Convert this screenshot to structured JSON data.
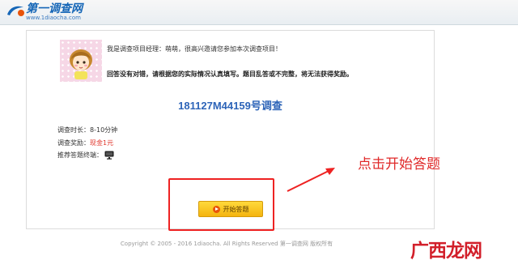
{
  "site": {
    "logo_text": "第一调查网",
    "logo_domain": "www.1diaocha.com"
  },
  "survey": {
    "greeting": "我是调查项目经理：萌萌，很高兴邀请您参加本次调查项目！",
    "instructions": "回答没有对错，请根据您的实际情况认真填写。题目乱答或不完整，将无法获得奖励。",
    "title": "181127M44159号调查",
    "duration_label": "调查时长：",
    "duration_value": "8-10分钟",
    "reward_label": "调查奖励：",
    "reward_value": "现金1元",
    "terminal_label": "推荐答题终端：",
    "terminal_icon": "desktop-monitor-icon",
    "start_button_label": "开始答题"
  },
  "annotation": {
    "text": "点击开始答题",
    "color": "#e02a2a"
  },
  "footer": {
    "copyright": "Copyright © 2005 - 2016 1diaocha. All Rights Reserved    第一调查网 版权所有"
  },
  "watermark": {
    "text": "广西龙网"
  },
  "colors": {
    "brand_blue": "#1566b7",
    "title_blue": "#2d64b8",
    "reward_red": "#e0352b",
    "button_yellow": "#f4b40f"
  }
}
